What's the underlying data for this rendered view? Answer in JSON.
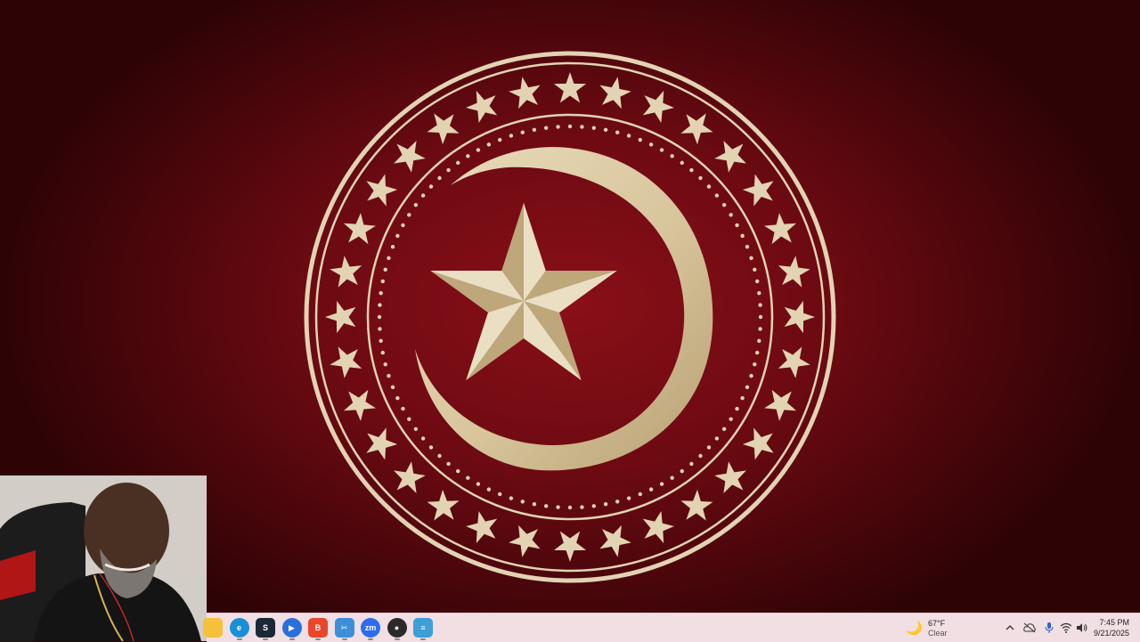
{
  "wallpaper": {
    "background_color": "#6d0a12",
    "emblem_color": "#e2d3b3",
    "outer_star_count": 32,
    "dot_count": 100
  },
  "webcam": {
    "description_icon": "person-icon"
  },
  "taskbar": {
    "background_color": "#f1dfe3",
    "apps": [
      {
        "name": "file-explorer",
        "icon": "folder-icon",
        "color": "#f3c23a",
        "glyph": ""
      },
      {
        "name": "edge",
        "icon": "edge-icon",
        "color": "#1b8fd6",
        "glyph": "e"
      },
      {
        "name": "steam",
        "icon": "steam-icon",
        "color": "#1b2838",
        "glyph": "S"
      },
      {
        "name": "media-player",
        "icon": "play-icon",
        "color": "#2a6fdb",
        "glyph": "▶"
      },
      {
        "name": "brave",
        "icon": "brave-icon",
        "color": "#e8472b",
        "glyph": "B"
      },
      {
        "name": "snipping-tool",
        "icon": "scissors-icon",
        "color": "#3b8fd9",
        "glyph": "✂"
      },
      {
        "name": "zoom",
        "icon": "zoom-icon",
        "color": "#2d6cf0",
        "glyph": "zm"
      },
      {
        "name": "obs",
        "icon": "obs-icon",
        "color": "#2a2a2a",
        "glyph": "●"
      },
      {
        "name": "notepad",
        "icon": "notepad-icon",
        "color": "#3d9fd8",
        "glyph": "≡"
      }
    ],
    "weather": {
      "icon": "moon-icon",
      "temperature": "67°F",
      "condition": "Clear"
    },
    "tray": {
      "overflow_icon": "chevron-up-icon",
      "cloud_icon": "cloud-off-icon",
      "mic_icon": "microphone-icon",
      "wifi_icon": "wifi-icon",
      "volume_icon": "speaker-icon"
    },
    "clock": {
      "time": "7:45 PM",
      "date": "9/21/2025"
    }
  }
}
